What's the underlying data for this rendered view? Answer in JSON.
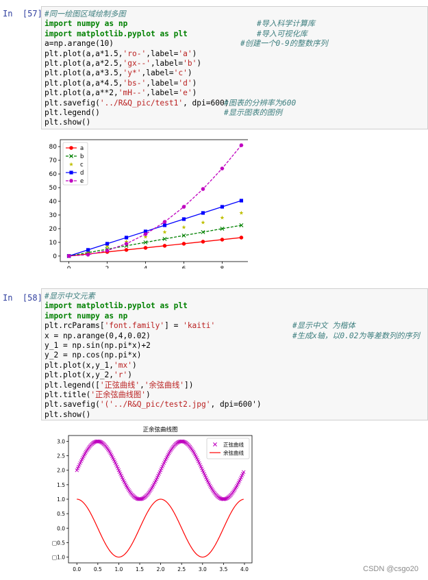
{
  "cells": [
    {
      "prompt": "In  [57]:",
      "lines": [
        {
          "code": [
            {
              "t": "#同一绘图区域绘制多图",
              "c": "cm"
            }
          ]
        },
        {
          "code": [
            {
              "t": "import",
              "c": "kw"
            },
            {
              "t": " "
            },
            {
              "t": "numpy",
              "c": "kw"
            },
            {
              "t": " "
            },
            {
              "t": "as",
              "c": "kw"
            },
            {
              "t": " "
            },
            {
              "t": "np",
              "c": "kw"
            }
          ],
          "comment": "#导入科学计算库"
        },
        {
          "code": [
            {
              "t": "import",
              "c": "kw"
            },
            {
              "t": " "
            },
            {
              "t": "matplotlib.pyplot",
              "c": "kw"
            },
            {
              "t": " "
            },
            {
              "t": "as",
              "c": "kw"
            },
            {
              "t": " "
            },
            {
              "t": "plt",
              "c": "kw"
            }
          ],
          "comment": "#导入可视化库"
        },
        {
          "code": [
            {
              "t": "a=np.arange(10)"
            }
          ],
          "comment": "#创建一个0-9的整数序列"
        },
        {
          "code": [
            {
              "t": "plt.plot(a,a*1.5,"
            },
            {
              "t": "'ro-'",
              "c": "st"
            },
            {
              "t": ",label="
            },
            {
              "t": "'a'",
              "c": "st"
            },
            {
              "t": ")"
            }
          ]
        },
        {
          "code": [
            {
              "t": "plt.plot(a,a*2.5,"
            },
            {
              "t": "'gx--'",
              "c": "st"
            },
            {
              "t": ",label="
            },
            {
              "t": "'b'",
              "c": "st"
            },
            {
              "t": ")"
            }
          ]
        },
        {
          "code": [
            {
              "t": "plt.plot(a,a*3.5,"
            },
            {
              "t": "'y*'",
              "c": "st"
            },
            {
              "t": ",label="
            },
            {
              "t": "'c'",
              "c": "st"
            },
            {
              "t": ")"
            }
          ]
        },
        {
          "code": [
            {
              "t": "plt.plot(a,a*4.5,"
            },
            {
              "t": "'bs-'",
              "c": "st"
            },
            {
              "t": ",label="
            },
            {
              "t": "'d'",
              "c": "st"
            },
            {
              "t": ")"
            }
          ]
        },
        {
          "code": [
            {
              "t": "plt.plot(a,a**2,"
            },
            {
              "t": "'mH--'",
              "c": "st"
            },
            {
              "t": ",label="
            },
            {
              "t": "'e'",
              "c": "st"
            },
            {
              "t": ")"
            }
          ]
        },
        {
          "code": [
            {
              "t": "plt.savefig("
            },
            {
              "t": "'../R&Q_pic/test1'",
              "c": "st"
            },
            {
              "t": ", dpi=600)"
            }
          ],
          "comment": "#图表的分辨率为600"
        },
        {
          "code": [
            {
              "t": "plt.legend()"
            }
          ],
          "comment": "#显示图表的图例"
        },
        {
          "code": [
            {
              "t": "plt.show()"
            }
          ]
        }
      ]
    },
    {
      "prompt": "In  [58]:",
      "lines": [
        {
          "code": [
            {
              "t": "#显示中文元素",
              "c": "cm"
            }
          ]
        },
        {
          "code": [
            {
              "t": "import",
              "c": "kw"
            },
            {
              "t": " "
            },
            {
              "t": "matplotlib.pyplot",
              "c": "kw"
            },
            {
              "t": " "
            },
            {
              "t": "as",
              "c": "kw"
            },
            {
              "t": " "
            },
            {
              "t": "plt",
              "c": "kw"
            }
          ]
        },
        {
          "code": [
            {
              "t": "import",
              "c": "kw"
            },
            {
              "t": " "
            },
            {
              "t": "numpy",
              "c": "kw"
            },
            {
              "t": " "
            },
            {
              "t": "as",
              "c": "kw"
            },
            {
              "t": " "
            },
            {
              "t": "np",
              "c": "kw"
            }
          ]
        },
        {
          "code": [
            {
              "t": "plt.rcParams["
            },
            {
              "t": "'font.family'",
              "c": "st"
            },
            {
              "t": "] = "
            },
            {
              "t": "'kaiti'",
              "c": "st"
            }
          ],
          "comment": "#显示中文 为楷体"
        },
        {
          "code": [
            {
              "t": "x = np.arange(0,4,0.02)"
            }
          ],
          "comment": "#生成x轴，以0.02为等差数列的序列"
        },
        {
          "code": [
            {
              "t": "y_1 = np.sin(np.pi*x)+2"
            }
          ]
        },
        {
          "code": [
            {
              "t": "y_2 = np.cos(np.pi*x)"
            }
          ]
        },
        {
          "code": [
            {
              "t": "plt.plot(x,y_1,"
            },
            {
              "t": "'mx'",
              "c": "st"
            },
            {
              "t": ")"
            }
          ]
        },
        {
          "code": [
            {
              "t": "plt.plot(x,y_2,"
            },
            {
              "t": "'r'",
              "c": "st"
            },
            {
              "t": ")"
            }
          ]
        },
        {
          "code": [
            {
              "t": "plt.legend(["
            },
            {
              "t": "'正弦曲线'",
              "c": "st"
            },
            {
              "t": ","
            },
            {
              "t": "'余弦曲线'",
              "c": "st"
            },
            {
              "t": "])"
            }
          ]
        },
        {
          "code": [
            {
              "t": "plt.title("
            },
            {
              "t": "'正余弦曲线图'",
              "c": "st"
            },
            {
              "t": ")"
            }
          ]
        },
        {
          "code": [
            {
              "t": "plt.savefig("
            },
            {
              "t": "'('../R&Q_pic/test2.jpg'",
              "c": "st"
            },
            {
              "t": ", dpi=600')"
            }
          ]
        },
        {
          "code": [
            {
              "t": "plt.show()"
            }
          ]
        }
      ]
    }
  ],
  "chart_data": [
    {
      "type": "line",
      "x": [
        0,
        1,
        2,
        3,
        4,
        5,
        6,
        7,
        8,
        9
      ],
      "series": [
        {
          "name": "a",
          "values": [
            0,
            1.5,
            3,
            4.5,
            6,
            7.5,
            9,
            10.5,
            12,
            13.5
          ],
          "color": "#ff0000",
          "marker": "circle",
          "line": "solid"
        },
        {
          "name": "b",
          "values": [
            0,
            2.5,
            5,
            7.5,
            10,
            12.5,
            15,
            17.5,
            20,
            22.5
          ],
          "color": "#008000",
          "marker": "x",
          "line": "dashed"
        },
        {
          "name": "c",
          "values": [
            0,
            3.5,
            7,
            10.5,
            14,
            17.5,
            21,
            24.5,
            28,
            31.5
          ],
          "color": "#bfbf00",
          "marker": "star",
          "line": "none"
        },
        {
          "name": "d",
          "values": [
            0,
            4.5,
            9,
            13.5,
            18,
            22.5,
            27,
            31.5,
            36,
            40.5
          ],
          "color": "#0000ff",
          "marker": "square",
          "line": "solid"
        },
        {
          "name": "e",
          "values": [
            0,
            1,
            4,
            9,
            16,
            25,
            36,
            49,
            64,
            81
          ],
          "color": "#bf00bf",
          "marker": "hexagon",
          "line": "dashed"
        }
      ],
      "xticks": [
        "0",
        "2",
        "4",
        "6",
        "8"
      ],
      "yticks": [
        "0",
        "10",
        "20",
        "30",
        "40",
        "50",
        "60",
        "70",
        "80"
      ],
      "xlim": [
        -0.45,
        9.45
      ],
      "ylim": [
        -4.05,
        85.05
      ],
      "legend": "top-left",
      "grid": false
    },
    {
      "type": "line",
      "title": "正余弦曲线图",
      "x_range": [
        0,
        3.98
      ],
      "x_step": 0.02,
      "series": [
        {
          "name": "正弦曲线",
          "formula": "sin(pi*x)+2",
          "color": "#bf00bf",
          "marker": "x",
          "line": "none"
        },
        {
          "name": "余弦曲线",
          "formula": "cos(pi*x)",
          "color": "#ff0000",
          "marker": "none",
          "line": "solid"
        }
      ],
      "xticks": [
        "0.0",
        "0.5",
        "1.0",
        "1.5",
        "2.0",
        "2.5",
        "3.0",
        "3.5",
        "4.0"
      ],
      "yticks": [
        "□1.0",
        "□0.5",
        "0.0",
        "0.5",
        "1.0",
        "1.5",
        "2.0",
        "2.5",
        "3.0"
      ],
      "xlim": [
        -0.2,
        4.18
      ],
      "ylim": [
        -1.2,
        3.2
      ],
      "legend": "top-right",
      "grid": false
    }
  ],
  "watermark": "CSDN @csgo20"
}
